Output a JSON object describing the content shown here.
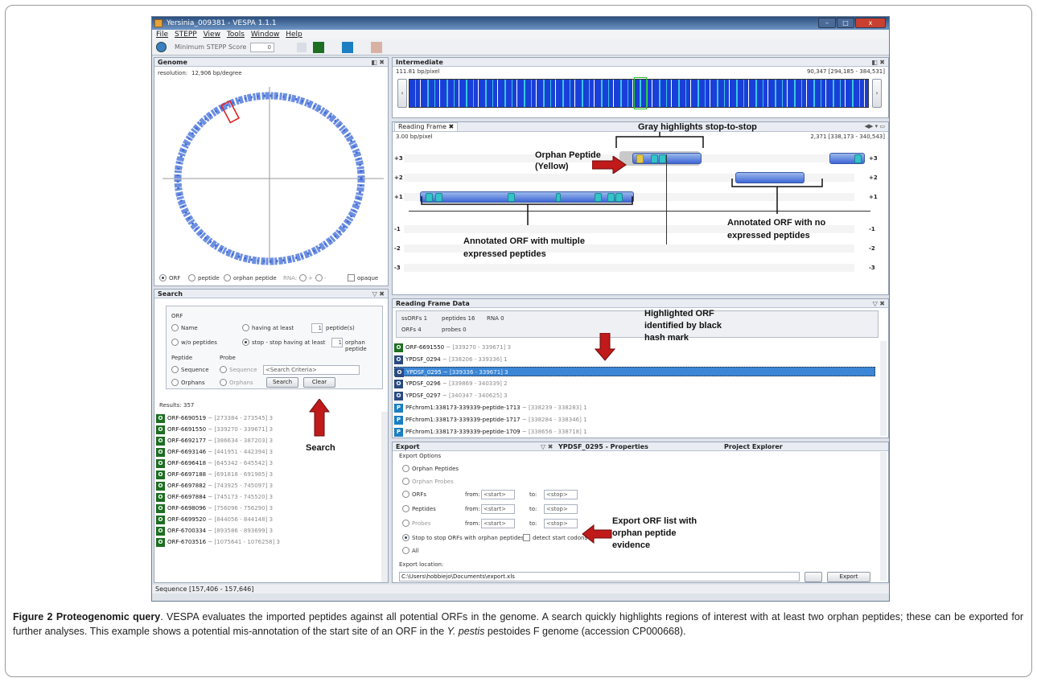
{
  "window": {
    "title": "Yersinia_009381 - VESPA 1.1.1",
    "menus": [
      "File",
      "STEPP",
      "View",
      "Tools",
      "Window",
      "Help"
    ],
    "toolbar": {
      "min_score_label": "Minimum STEPP Score",
      "min_score_value": "0"
    }
  },
  "genome": {
    "title": "Genome",
    "resolution_label": "resolution:",
    "resolution_value": "12,906 bp/degree",
    "options": [
      "ORF",
      "peptide",
      "orphan peptide"
    ],
    "rna_label": "RNA:",
    "rna_plus": "+",
    "rna_minus": "-",
    "opaque_label": "opaque"
  },
  "intermediate": {
    "title": "Intermediate",
    "scale": "111.81 bp/pixel",
    "range": "90,347 [294,185 - 384,531]"
  },
  "reading_frame": {
    "tab": "Reading Frame",
    "scale": "3.00 bp/pixel",
    "range": "2,371 [338,173 - 340,543]",
    "frames": [
      "+3",
      "+2",
      "+1",
      "-1",
      "-2",
      "-3"
    ]
  },
  "annotations": {
    "gray": "Gray highlights stop-to-stop",
    "orphan_line1": "Orphan Peptide",
    "orphan_line2": "(Yellow)",
    "annotated_multi_line1": "Annotated ORF with multiple",
    "annotated_multi_line2": "expressed peptides",
    "annotated_none_line1": "Annotated ORF with no",
    "annotated_none_line2": "expressed peptides",
    "highlighted_line1": "Highlighted ORF",
    "highlighted_line2": "identified by black",
    "highlighted_line3": "hash mark",
    "search": "Search",
    "export_line1": "Export ORF list with",
    "export_line2": "orphan peptide",
    "export_line3": "evidence"
  },
  "search": {
    "title": "Search",
    "orf_label": "ORF",
    "name": "Name",
    "wo_peptides": "w/o peptides",
    "having_at_least": "having at least",
    "having_value": "1",
    "peptides_suffix": "peptide(s)",
    "stop_label": "stop - stop having at least",
    "stop_value": "1",
    "orphan_suffix": "orphan peptide",
    "peptide_label": "Peptide",
    "probe_label": "Probe",
    "sequence": "Sequence",
    "orphans": "Orphans",
    "criteria_placeholder": "<Search Criteria>",
    "search_btn": "Search",
    "clear_btn": "Clear",
    "results_label": "Results:",
    "results_count": "357",
    "results": [
      {
        "name": "ORF-6690519",
        "range": "[273384 - 273545]",
        "n": "3"
      },
      {
        "name": "ORF-6691550",
        "range": "[339270 - 339671]",
        "n": "3"
      },
      {
        "name": "ORF-6692177",
        "range": "[386634 - 387203]",
        "n": "3"
      },
      {
        "name": "ORF-6693146",
        "range": "[441951 - 442394]",
        "n": "3"
      },
      {
        "name": "ORF-6696418",
        "range": "[645342 - 645542]",
        "n": "3"
      },
      {
        "name": "ORF-6697188",
        "range": "[691818 - 691985]",
        "n": "3"
      },
      {
        "name": "ORF-6697882",
        "range": "[743925 - 745097]",
        "n": "3"
      },
      {
        "name": "ORF-6697884",
        "range": "[745173 - 745520]",
        "n": "3"
      },
      {
        "name": "ORF-6698096",
        "range": "[756096 - 756290]",
        "n": "3"
      },
      {
        "name": "ORF-6699520",
        "range": "[844056 - 844148]",
        "n": "3"
      },
      {
        "name": "ORF-6700334",
        "range": "[893586 - 893699]",
        "n": "3"
      },
      {
        "name": "ORF-6703516",
        "range": "[1075641 - 1076258]",
        "n": "3"
      }
    ]
  },
  "rfdata": {
    "title": "Reading Frame Data",
    "ssorfs": "ssORFs 1",
    "orfs": "ORFs 4",
    "peptides": "peptides 16",
    "probes": "probes 0",
    "rna": "RNA 0",
    "rows": [
      {
        "icon": "O",
        "name": "ORF-6691550",
        "range": "[339270 - 339671]",
        "n": "3"
      },
      {
        "icon": "Y",
        "name": "YPDSF_0294",
        "range": "[338206 - 339336]",
        "n": "1"
      },
      {
        "icon": "Y",
        "name": "YPDSF_0295",
        "range": "[339336 - 339671]",
        "n": "3"
      },
      {
        "icon": "Y",
        "name": "YPDSF_0296",
        "range": "[339869 - 340339]",
        "n": "2"
      },
      {
        "icon": "Y",
        "name": "YPDSF_0297",
        "range": "[340347 - 340625]",
        "n": "3"
      },
      {
        "icon": "P",
        "name": "PFchrom1:338173-339339-peptide-1713",
        "range": "[338239 - 338283]",
        "n": "1"
      },
      {
        "icon": "P",
        "name": "PFchrom1:338173-339339-peptide-1717",
        "range": "[338284 - 338346]",
        "n": "1"
      },
      {
        "icon": "P",
        "name": "PFchrom1:338173-339339-peptide-1709",
        "range": "[338656 - 338718]",
        "n": "1"
      }
    ]
  },
  "export": {
    "title": "Export",
    "tab2": "YPDSF_0295 - Properties",
    "tab3": "Project Explorer",
    "options_label": "Export Options",
    "orphan_peptides": "Orphan Peptides",
    "orphan_probes": "Orphan Probes",
    "orfs": "ORFs",
    "peptides": "Peptides",
    "probes": "Probes",
    "from": "from:",
    "to": "to:",
    "start": "<start>",
    "stop": "<stop>",
    "stop_to_stop": "Stop to stop ORFs with orphan peptides",
    "detect": "detect start codons",
    "all": "All",
    "location_label": "Export location:",
    "location_value": "C:\\Users\\hobbiejo\\Documents\\export.xls",
    "export_btn": "Export"
  },
  "status": "Sequence [157,406 - 157,646]",
  "caption": {
    "label": "Figure 2 Proteogenomic query",
    "text1": ". VESPA evaluates the imported peptides against all potential ORFs in the genome. A search quickly highlights regions of interest with at least two orphan peptides; these can be exported for further analyses. This example shows a potential mis-annotation of the start site of an ORF in the ",
    "species": "Y. pestis",
    "text2": " pestoides F genome (accession CP000668)."
  }
}
